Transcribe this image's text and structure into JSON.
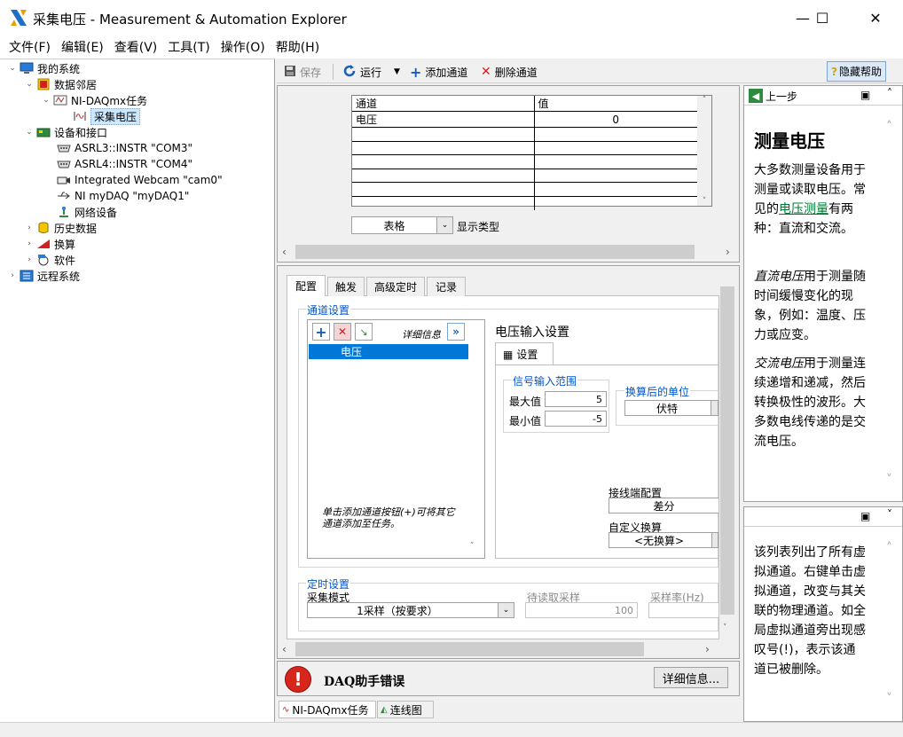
{
  "window": {
    "title": "采集电压 - Measurement & Automation Explorer",
    "minimize": "—",
    "maximize": "☐",
    "close": "✕"
  },
  "menu": [
    "文件(F)",
    "编辑(E)",
    "查看(V)",
    "工具(T)",
    "操作(O)",
    "帮助(H)"
  ],
  "tree": {
    "my_system": "我的系统",
    "data_neighborhood": "数据邻居",
    "daqmx_tasks": "NI-DAQmx任务",
    "task_voltage": "采集电压",
    "devices": "设备和接口",
    "asrl3": "ASRL3::INSTR \"COM3\"",
    "asrl4": "ASRL4::INSTR \"COM4\"",
    "webcam": "Integrated Webcam  \"cam0\"",
    "mydaq": "NI myDAQ \"myDAQ1\"",
    "network": "网络设备",
    "history": "历史数据",
    "scaling": "换算",
    "software": "软件",
    "remote": "远程系统"
  },
  "toolbar": {
    "save": "保存",
    "run": "运行",
    "add_channel": "添加通道",
    "delete_channel": "删除通道",
    "hide_help": "隐藏帮助"
  },
  "table": {
    "col_channel": "通道",
    "col_value": "值",
    "rows": [
      {
        "channel": "电压",
        "value": "0"
      }
    ]
  },
  "display": {
    "type_value": "表格",
    "type_label": "显示类型"
  },
  "tabs": [
    "配置",
    "触发",
    "高级定时",
    "记录"
  ],
  "channel_settings": {
    "group_title": "通道设置",
    "details": "详细信息",
    "channels": [
      "电压"
    ],
    "hint": "单击添加通道按钮(+)可将其它通道添加至任务。"
  },
  "voltage_settings": {
    "title": "电压输入设置",
    "subtab": "设置",
    "signal_range": "信号输入范围",
    "max_label": "最大值",
    "max_value": "5",
    "min_label": "最小值",
    "min_value": "-5",
    "units_title": "换算后的单位",
    "units_value": "伏特",
    "terminal_label": "接线端配置",
    "terminal_value": "差分",
    "custom_scale_label": "自定义换算",
    "custom_scale_value": "<无换算>"
  },
  "timing": {
    "group_title": "定时设置",
    "mode_label": "采集模式",
    "mode_value": "1采样（按要求）",
    "samples_label": "待读取采样",
    "samples_value": "100",
    "rate_label": "采样率(Hz)"
  },
  "error": {
    "text": "DAQ助手错误",
    "details_button": "详细信息..."
  },
  "bottom_tabs": [
    "NI-DAQmx任务",
    "连线图"
  ],
  "help": {
    "back": "上一步",
    "heading": "测量电压",
    "p1_pre": "大多数测量设备用于测量或读取电压。常见的",
    "p1_link": "电压测量",
    "p1_post": "有两种：直流和交流。",
    "p2_italic": "直流电压",
    "p2_text": "用于测量随时间缓慢变化的现象，例如：温度、压力或应变。",
    "p3_italic": "交流电压",
    "p3_text": "用于测量连续递增和递减，然后转换极性的波形。大多数电线传递的是交流电压。",
    "bottom_text": "该列表列出了所有虚拟通道。右键单击虚拟通道，改变与其关联的物理通道。如全局虚拟通道旁出现感叹号(!)，表示该通道已被删除。"
  },
  "colors": {
    "accent_blue": "#0055cc",
    "error_red": "#d9261c",
    "selection": "#0078d7",
    "link_green": "#007a33"
  }
}
